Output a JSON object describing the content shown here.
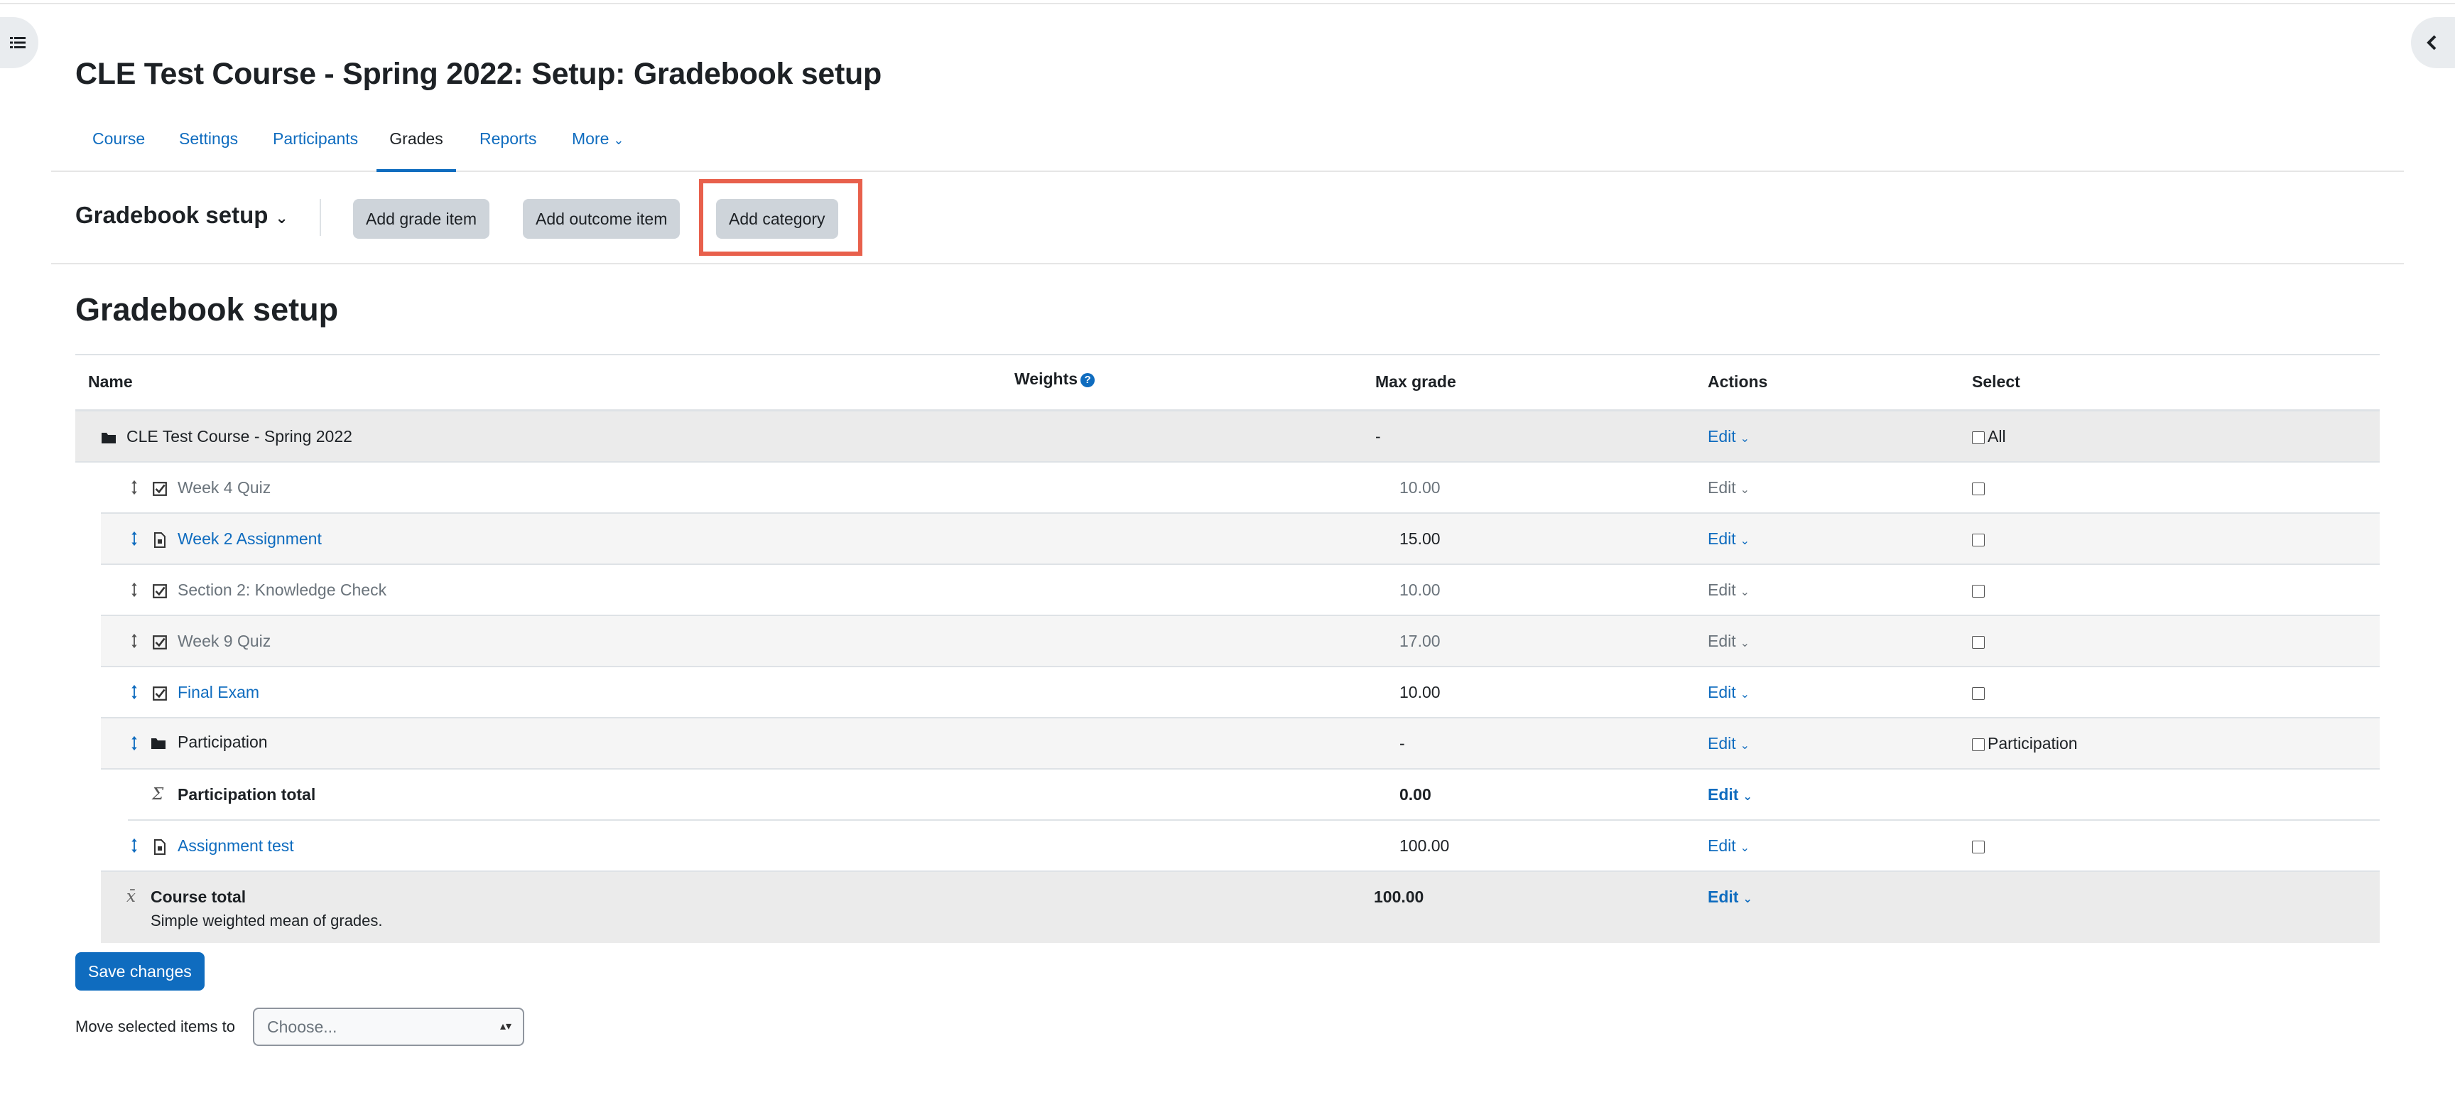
{
  "page": {
    "title": "CLE Test Course - Spring 2022: Setup: Gradebook setup",
    "section_heading": "Gradebook setup"
  },
  "nav": {
    "tabs": [
      {
        "label": "Course",
        "active": false
      },
      {
        "label": "Settings",
        "active": false
      },
      {
        "label": "Participants",
        "active": false
      },
      {
        "label": "Grades",
        "active": true
      },
      {
        "label": "Reports",
        "active": false
      },
      {
        "label": "More",
        "active": false
      }
    ]
  },
  "toolbar": {
    "selector_label": "Gradebook setup",
    "add_grade_item": "Add grade item",
    "add_outcome_item": "Add outcome item",
    "add_category": "Add category",
    "highlighted": "Add category"
  },
  "table": {
    "headers": {
      "name": "Name",
      "weights": "Weights",
      "max_grade": "Max grade",
      "actions": "Actions",
      "select": "Select"
    },
    "rows": [
      {
        "name": "CLE Test Course - Spring 2022",
        "type": "category",
        "max": "-",
        "edit": "Edit",
        "select": "All"
      },
      {
        "name": "Week 4 Quiz",
        "type": "quiz",
        "max": "10.00",
        "edit": "Edit",
        "hidden": true
      },
      {
        "name": "Week 2 Assignment",
        "type": "assignment",
        "max": "15.00",
        "edit": "Edit"
      },
      {
        "name": "Section 2: Knowledge Check",
        "type": "quiz",
        "max": "10.00",
        "edit": "Edit",
        "hidden": true
      },
      {
        "name": "Week 9 Quiz",
        "type": "quiz",
        "max": "17.00",
        "edit": "Edit",
        "hidden": true
      },
      {
        "name": "Final Exam",
        "type": "quiz",
        "max": "10.00",
        "edit": "Edit"
      },
      {
        "name": "Participation",
        "type": "category",
        "max": "-",
        "edit": "Edit",
        "select": "Participation"
      },
      {
        "name": "Participation total",
        "type": "total",
        "max": "0.00",
        "edit": "Edit"
      },
      {
        "name": "Assignment test",
        "type": "assignment",
        "max": "100.00",
        "edit": "Edit"
      },
      {
        "name": "Course total",
        "type": "course-total",
        "max": "100.00",
        "edit": "Edit",
        "subtext": "Simple weighted mean of grades."
      }
    ]
  },
  "footer": {
    "save_changes": "Save changes",
    "move_label": "Move selected items to",
    "move_placeholder": "Choose..."
  },
  "colors": {
    "link": "#0f6cbf",
    "highlight": "#e8604c",
    "button_secondary": "#ced4da"
  }
}
